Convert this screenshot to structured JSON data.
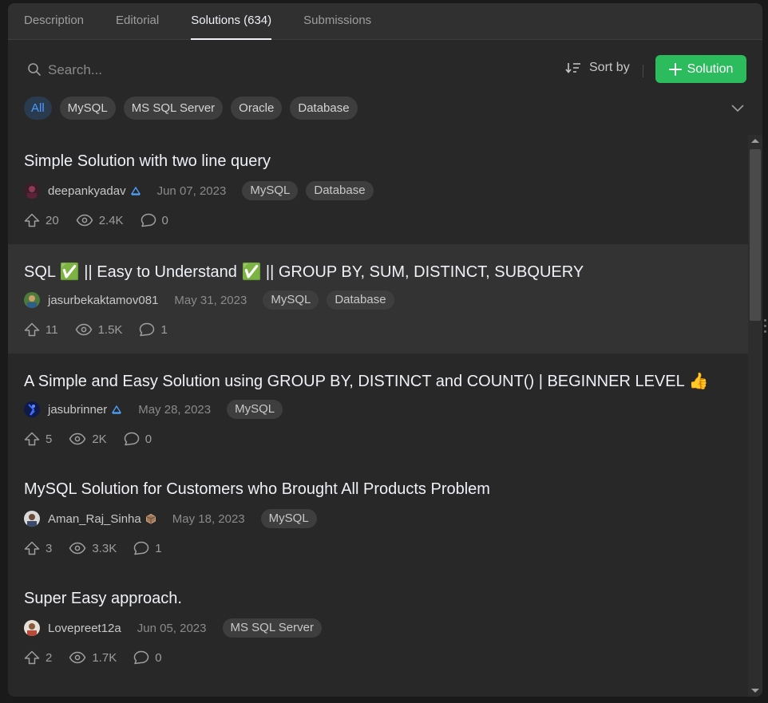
{
  "tabs": [
    {
      "label": "Description"
    },
    {
      "label": "Editorial"
    },
    {
      "label": "Solutions (634)"
    },
    {
      "label": "Submissions"
    }
  ],
  "active_tab": 2,
  "search": {
    "placeholder": "Search..."
  },
  "sort": {
    "label": "Sort by"
  },
  "add_solution": {
    "label": "Solution"
  },
  "filters": [
    {
      "label": "All"
    },
    {
      "label": "MySQL"
    },
    {
      "label": "MS SQL Server"
    },
    {
      "label": "Oracle"
    },
    {
      "label": "Database"
    }
  ],
  "colors": {
    "accent_green": "#2cbb5d",
    "active_filter_text": "#4a9cff",
    "panel_bg": "#282828"
  },
  "solutions": [
    {
      "title": "Simple Solution with two line query",
      "author": "deepankyadav",
      "badge": "knight-badge",
      "date": "Jun 07, 2023",
      "tags": [
        "MySQL",
        "Database"
      ],
      "upvotes": "20",
      "views": "2.4K",
      "comments": "0"
    },
    {
      "title": "SQL ✅ || Easy to Understand ✅ || GROUP BY, SUM, DISTINCT, SUBQUERY",
      "author": "jasurbekaktamov081",
      "badge": "",
      "date": "May 31, 2023",
      "tags": [
        "MySQL",
        "Database"
      ],
      "upvotes": "11",
      "views": "1.5K",
      "comments": "1"
    },
    {
      "title": "A Simple and Easy Solution using GROUP BY, DISTINCT and COUNT() | BEGINNER LEVEL 👍",
      "author": "jasubrinner",
      "badge": "knight-badge",
      "date": "May 28, 2023",
      "tags": [
        "MySQL"
      ],
      "upvotes": "5",
      "views": "2K",
      "comments": "0"
    },
    {
      "title": "MySQL Solution for Customers who Brought All Products Problem",
      "author": "Aman_Raj_Sinha",
      "badge": "box-badge",
      "date": "May 18, 2023",
      "tags": [
        "MySQL"
      ],
      "upvotes": "3",
      "views": "3.3K",
      "comments": "1"
    },
    {
      "title": "Super Easy approach.",
      "author": "Lovepreet12a",
      "badge": "",
      "date": "Jun 05, 2023",
      "tags": [
        "MS SQL Server"
      ],
      "upvotes": "2",
      "views": "1.7K",
      "comments": "0"
    }
  ]
}
